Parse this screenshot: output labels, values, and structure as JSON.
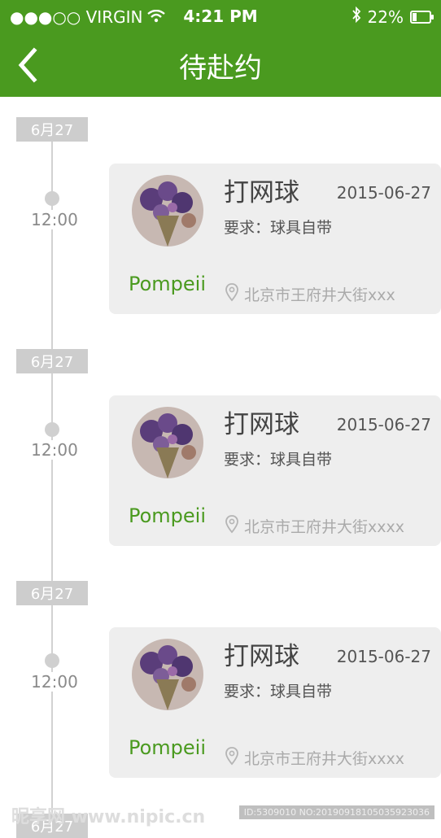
{
  "status_bar": {
    "carrier": "●●●○○ VIRGIN",
    "time": "4:21 PM",
    "battery": "22%",
    "battery_level": 0.22
  },
  "header": {
    "title": "待赴约"
  },
  "colors": {
    "brand_green": "#4a9a1f",
    "card_bg": "#eeeeee",
    "badge_bg": "#cdcdcd"
  },
  "entries": [
    {
      "date_badge": "6月27",
      "time": "12:00",
      "title": "打网球",
      "date": "2015-06-27",
      "requirement": "要求：球具自带",
      "user": "Pompeii",
      "location": "北京市王府井大街xxx"
    },
    {
      "date_badge": "6月27",
      "time": "12:00",
      "title": "打网球",
      "date": "2015-06-27",
      "requirement": "要求：球具自带",
      "user": "Pompeii",
      "location": "北京市王府井大街xxxx"
    },
    {
      "date_badge": "6月27",
      "time": "12:00",
      "title": "打网球",
      "date": "2015-06-27",
      "requirement": "要求：球具自带",
      "user": "Pompeii",
      "location": "北京市王府井大街xxxx"
    },
    {
      "date_badge": "6月27"
    }
  ],
  "watermark": {
    "left": "昵享网 www.nipic.cn",
    "right": "ID:5309010 NO:20190918105035923036"
  }
}
